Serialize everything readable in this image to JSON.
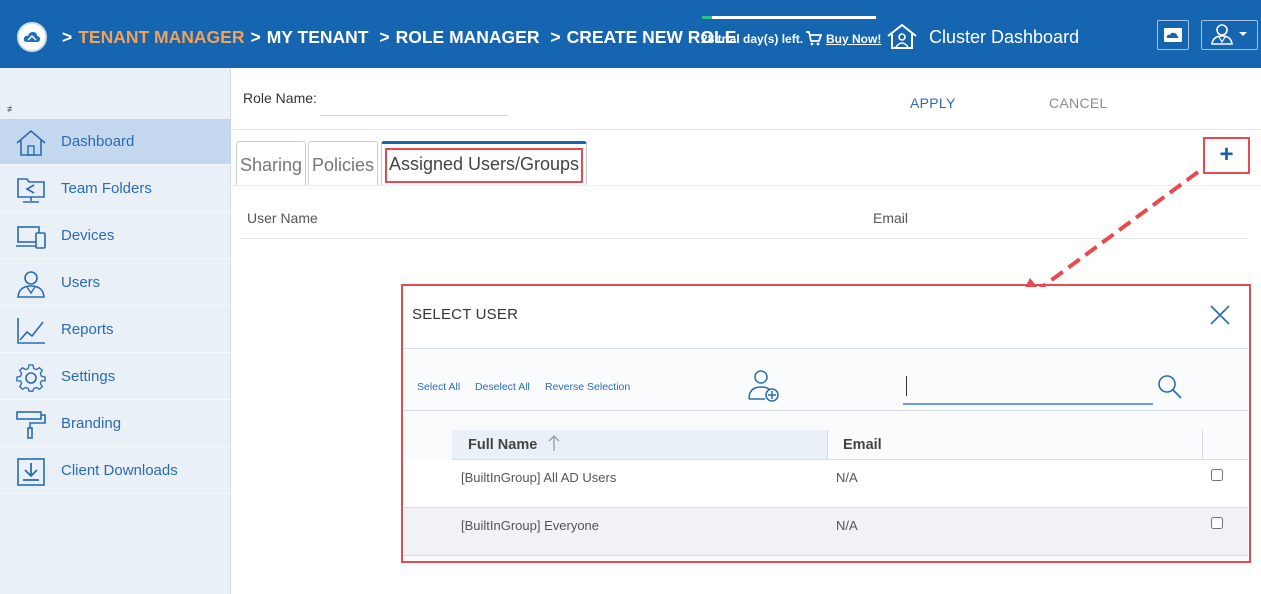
{
  "header": {
    "breadcrumb": [
      {
        "label": "TENANT MANAGER",
        "active": true
      },
      {
        "label": "MY TENANT",
        "active": false
      },
      {
        "label": "ROLE MANAGER",
        "active": false
      },
      {
        "label": "CREATE NEW ROLE",
        "active": false
      }
    ],
    "trial_text": "28 trial day(s) left.",
    "trial_progress": 0.06,
    "buy_now": "Buy Now!",
    "cluster_dashboard": "Cluster Dashboard",
    "colors": {
      "bar": "#1565b0",
      "active_crumb": "#f0a25a",
      "trial_fill": "#27c08a"
    }
  },
  "sidebar": {
    "collapse_icon": "collapse-icon",
    "items": [
      {
        "label": "Dashboard",
        "icon": "home-icon",
        "active": true
      },
      {
        "label": "Team Folders",
        "icon": "team-folder-icon",
        "active": false
      },
      {
        "label": "Devices",
        "icon": "devices-icon",
        "active": false
      },
      {
        "label": "Users",
        "icon": "user-icon",
        "active": false
      },
      {
        "label": "Reports",
        "icon": "chart-icon",
        "active": false
      },
      {
        "label": "Settings",
        "icon": "gear-icon",
        "active": false
      },
      {
        "label": "Branding",
        "icon": "paint-roller-icon",
        "active": false
      },
      {
        "label": "Client Downloads",
        "icon": "download-icon",
        "active": false
      }
    ]
  },
  "form": {
    "role_name_label": "Role Name:",
    "role_name_value": "",
    "apply": "APPLY",
    "cancel": "CANCEL"
  },
  "tabs": [
    {
      "label": "Sharing",
      "active": false
    },
    {
      "label": "Policies",
      "active": false
    },
    {
      "label": "Assigned Users/Groups",
      "active": true
    }
  ],
  "assigned_table": {
    "add_button": "+",
    "columns": [
      "User Name",
      "Email"
    ]
  },
  "modal": {
    "title": "SELECT USER",
    "toolbar": {
      "select_all": "Select All",
      "deselect_all": "Deselect All",
      "reverse_selection": "Reverse Selection"
    },
    "search_value": "",
    "columns": {
      "name": "Full Name",
      "email": "Email"
    },
    "rows": [
      {
        "name": "[BuiltInGroup] All AD Users",
        "email": "N/A",
        "checked": false
      },
      {
        "name": "[BuiltInGroup] Everyone",
        "email": "N/A",
        "checked": false
      }
    ]
  },
  "annotation_color": "#e84a4f"
}
